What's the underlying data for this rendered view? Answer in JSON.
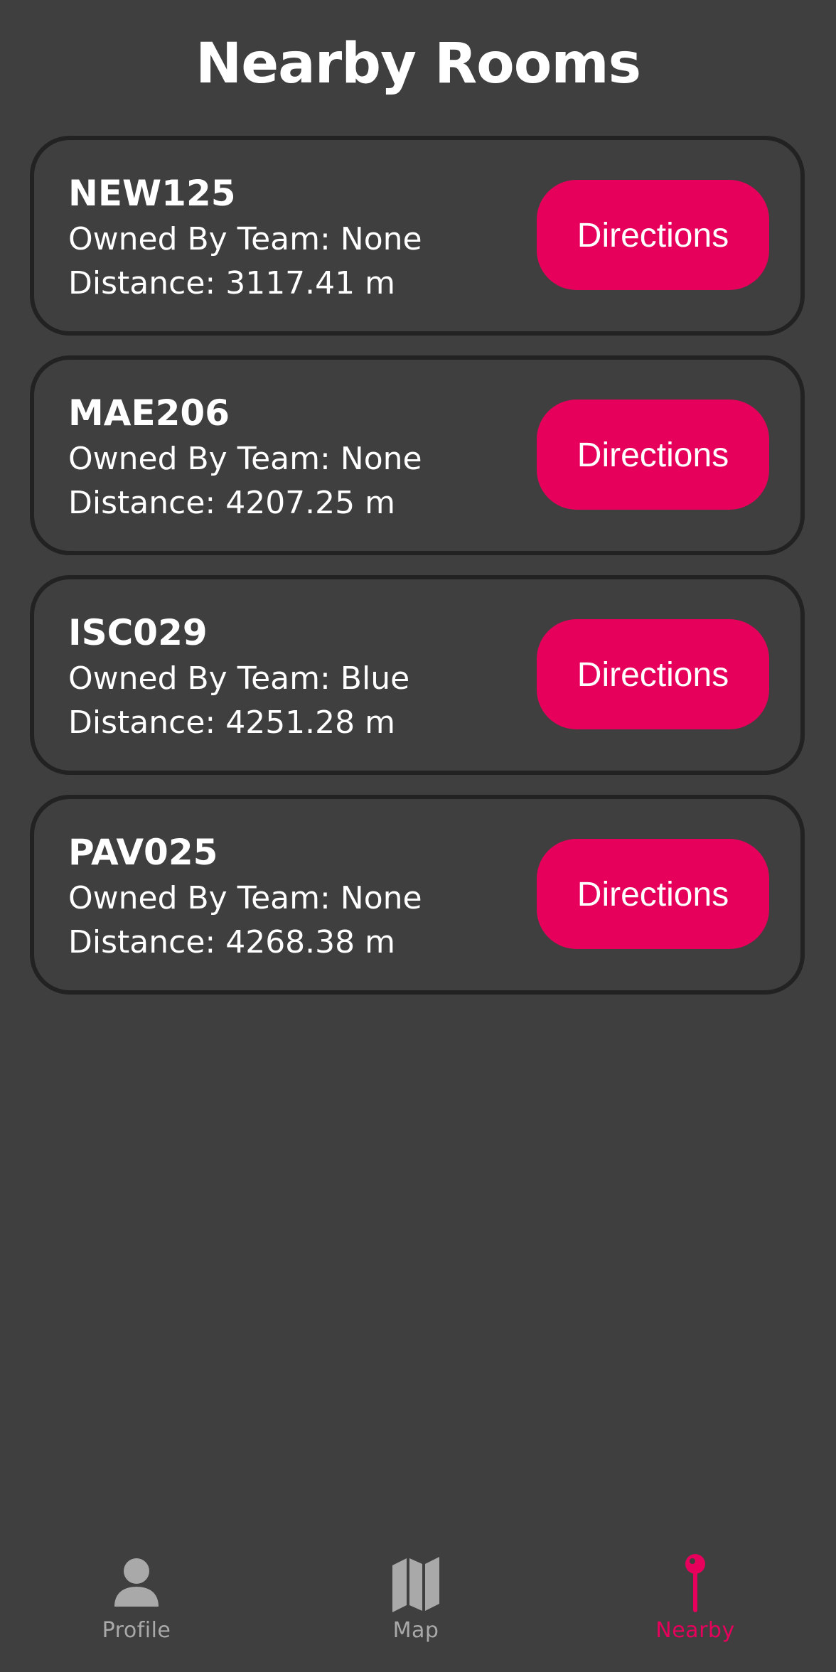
{
  "header": {
    "title": "Nearby Rooms"
  },
  "rooms": [
    {
      "name": "NEW125",
      "owner": "Owned By Team: None",
      "distance": "Distance: 3117.41 m",
      "button": "Directions"
    },
    {
      "name": "MAE206",
      "owner": "Owned By Team: None",
      "distance": "Distance: 4207.25 m",
      "button": "Directions"
    },
    {
      "name": "ISC029",
      "owner": "Owned By Team: Blue",
      "distance": "Distance: 4251.28 m",
      "button": "Directions"
    },
    {
      "name": "PAV025",
      "owner": "Owned By Team: None",
      "distance": "Distance: 4268.38 m",
      "button": "Directions"
    }
  ],
  "tabbar": {
    "tabs": [
      {
        "label": "Profile",
        "icon": "person-icon",
        "active": false
      },
      {
        "label": "Map",
        "icon": "map-icon",
        "active": false
      },
      {
        "label": "Nearby",
        "icon": "pin-icon",
        "active": true
      }
    ]
  },
  "colors": {
    "accent": "#e6005c",
    "background": "#3f3f3f",
    "card_border": "#222222",
    "inactive_tab": "#a9a9a9"
  }
}
